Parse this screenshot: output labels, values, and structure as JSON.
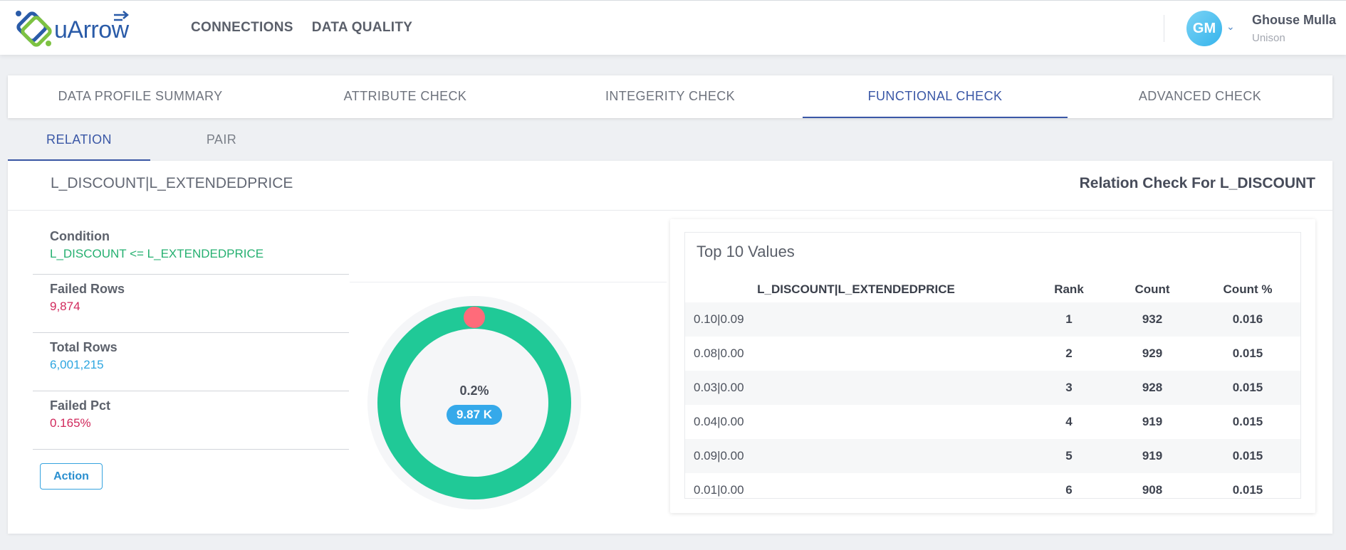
{
  "brand": {
    "name": "uArrow"
  },
  "nav": {
    "links": [
      "CONNECTIONS",
      "DATA QUALITY"
    ]
  },
  "user": {
    "initials": "GM",
    "name": "Ghouse Mulla",
    "org": "Unison"
  },
  "main_tabs": [
    {
      "label": "DATA PROFILE SUMMARY",
      "active": false
    },
    {
      "label": "ATTRIBUTE CHECK",
      "active": false
    },
    {
      "label": "INTEGERITY CHECK",
      "active": false
    },
    {
      "label": "FUNCTIONAL CHECK",
      "active": true
    },
    {
      "label": "ADVANCED CHECK",
      "active": false
    }
  ],
  "sub_tabs": [
    {
      "label": "RELATION",
      "active": true
    },
    {
      "label": "PAIR",
      "active": false
    }
  ],
  "check": {
    "pair": "L_DISCOUNT|L_EXTENDEDPRICE",
    "title": "Relation Check For L_DISCOUNT",
    "condition_label": "Condition",
    "condition": "L_DISCOUNT <= L_EXTENDEDPRICE",
    "failed_rows_label": "Failed Rows",
    "failed_rows": "9,874",
    "total_rows_label": "Total Rows",
    "total_rows": "6,001,215",
    "failed_pct_label": "Failed Pct",
    "failed_pct": "0.165%",
    "action_label": "Action"
  },
  "donut": {
    "percent_label": "0.2%",
    "badge": "9.87 K",
    "failed_fraction": 0.00165,
    "pass_color": "#20c997",
    "fail_color": "#ff6b7a"
  },
  "top_values": {
    "title": "Top 10 Values",
    "columns": [
      "L_DISCOUNT|L_EXTENDEDPRICE",
      "Rank",
      "Count",
      "Count %"
    ],
    "rows": [
      [
        "0.10|0.09",
        "1",
        "932",
        "0.016"
      ],
      [
        "0.08|0.00",
        "2",
        "929",
        "0.015"
      ],
      [
        "0.03|0.00",
        "3",
        "928",
        "0.015"
      ],
      [
        "0.04|0.00",
        "4",
        "919",
        "0.015"
      ],
      [
        "0.09|0.00",
        "5",
        "919",
        "0.015"
      ],
      [
        "0.01|0.00",
        "6",
        "908",
        "0.015"
      ]
    ]
  }
}
